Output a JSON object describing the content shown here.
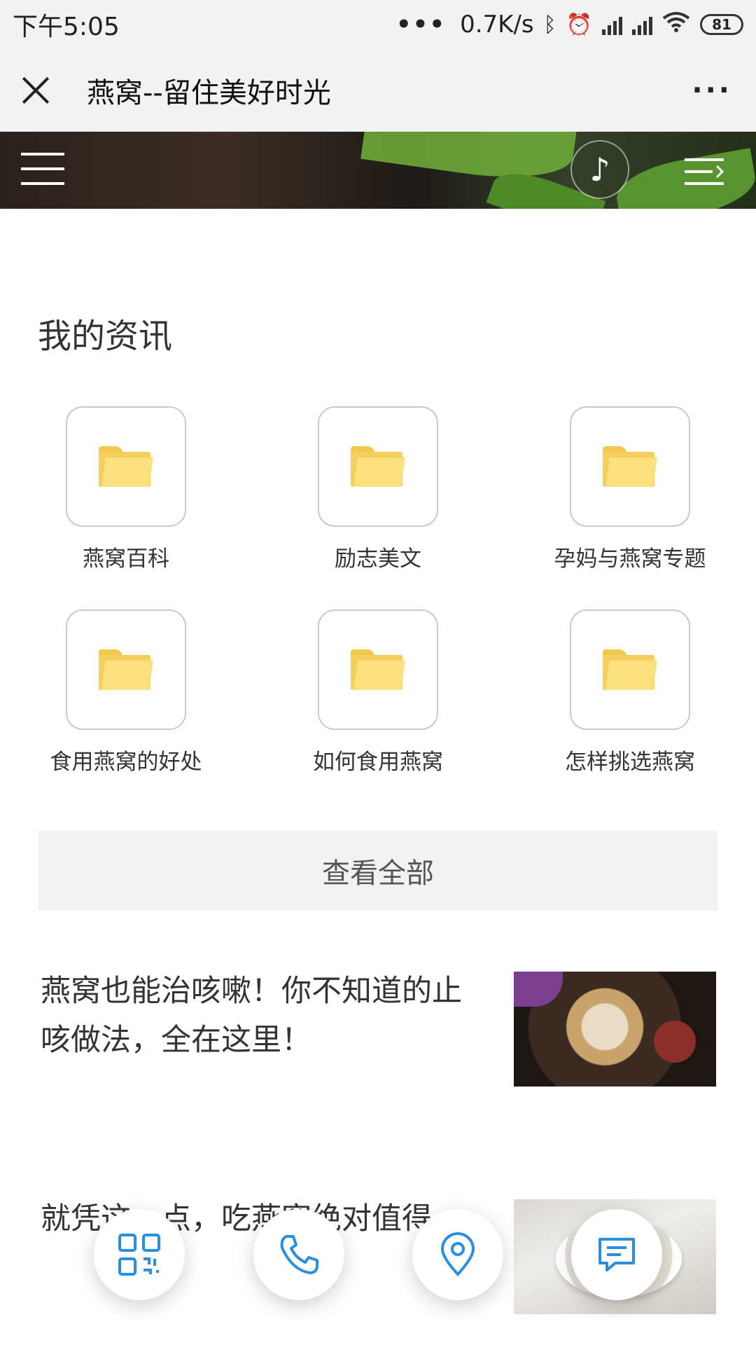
{
  "status_bar": {
    "time": "下午5:05",
    "network_speed": "0.7K/s",
    "battery": "81",
    "icons": [
      "more-dots-icon",
      "bluetooth-icon",
      "alarm-icon",
      "hd-signal-icon",
      "signal-icon",
      "wifi-icon",
      "battery-icon"
    ]
  },
  "title_bar": {
    "title": "燕窝--留住美好时光",
    "more_label": "···"
  },
  "banner": {
    "music_icon": "♪"
  },
  "section": {
    "title": "我的资讯",
    "categories": [
      {
        "label": "燕窝百科",
        "icon": "folder-icon"
      },
      {
        "label": "励志美文",
        "icon": "folder-icon"
      },
      {
        "label": "孕妈与燕窝专题",
        "icon": "folder-icon"
      },
      {
        "label": "食用燕窝的好处",
        "icon": "folder-icon"
      },
      {
        "label": "如何食用燕窝",
        "icon": "folder-icon"
      },
      {
        "label": "怎样挑选燕窝",
        "icon": "folder-icon"
      }
    ],
    "view_all": "查看全部"
  },
  "articles": [
    {
      "title": "燕窝也能治咳嗽！你不知道的止咳做法，全在这里！"
    },
    {
      "title": "就凭这一点，吃燕窝绝对值得"
    }
  ],
  "fabs": [
    {
      "name": "qrcode-button",
      "icon": "qrcode-icon"
    },
    {
      "name": "phone-button",
      "icon": "phone-icon"
    },
    {
      "name": "location-button",
      "icon": "location-pin-icon"
    },
    {
      "name": "message-button",
      "icon": "chat-icon"
    }
  ],
  "colors": {
    "accent": "#2b8fe0",
    "folder": "#fbe07e",
    "view_all_bg": "#f2f2f2"
  }
}
